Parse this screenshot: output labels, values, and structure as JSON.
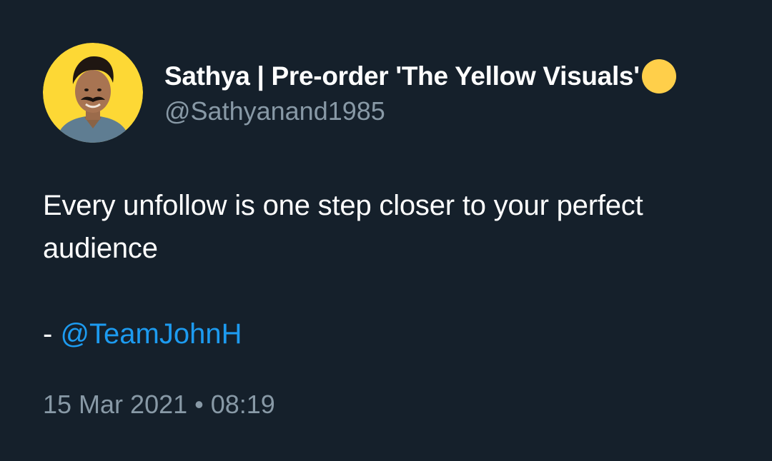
{
  "tweet": {
    "author": {
      "display_name": "Sathya | Pre-order 'The Yellow Visuals'",
      "handle": "@Sathyanand1985",
      "emoji": "yellow-circle-emoji",
      "avatar": "profile-avatar"
    },
    "text_line": "Every unfollow is one step closer to your perfect audience",
    "quote_prefix": "- ",
    "mention": "@TeamJohnH",
    "timestamp": "15 Mar 2021 • 08:19"
  },
  "colors": {
    "background": "#15202b",
    "text": "#ffffff",
    "secondary": "#8899a6",
    "link": "#1d9bf0",
    "avatar_bg": "#ffd43b",
    "emoji_yellow": "#ffcf4a"
  }
}
